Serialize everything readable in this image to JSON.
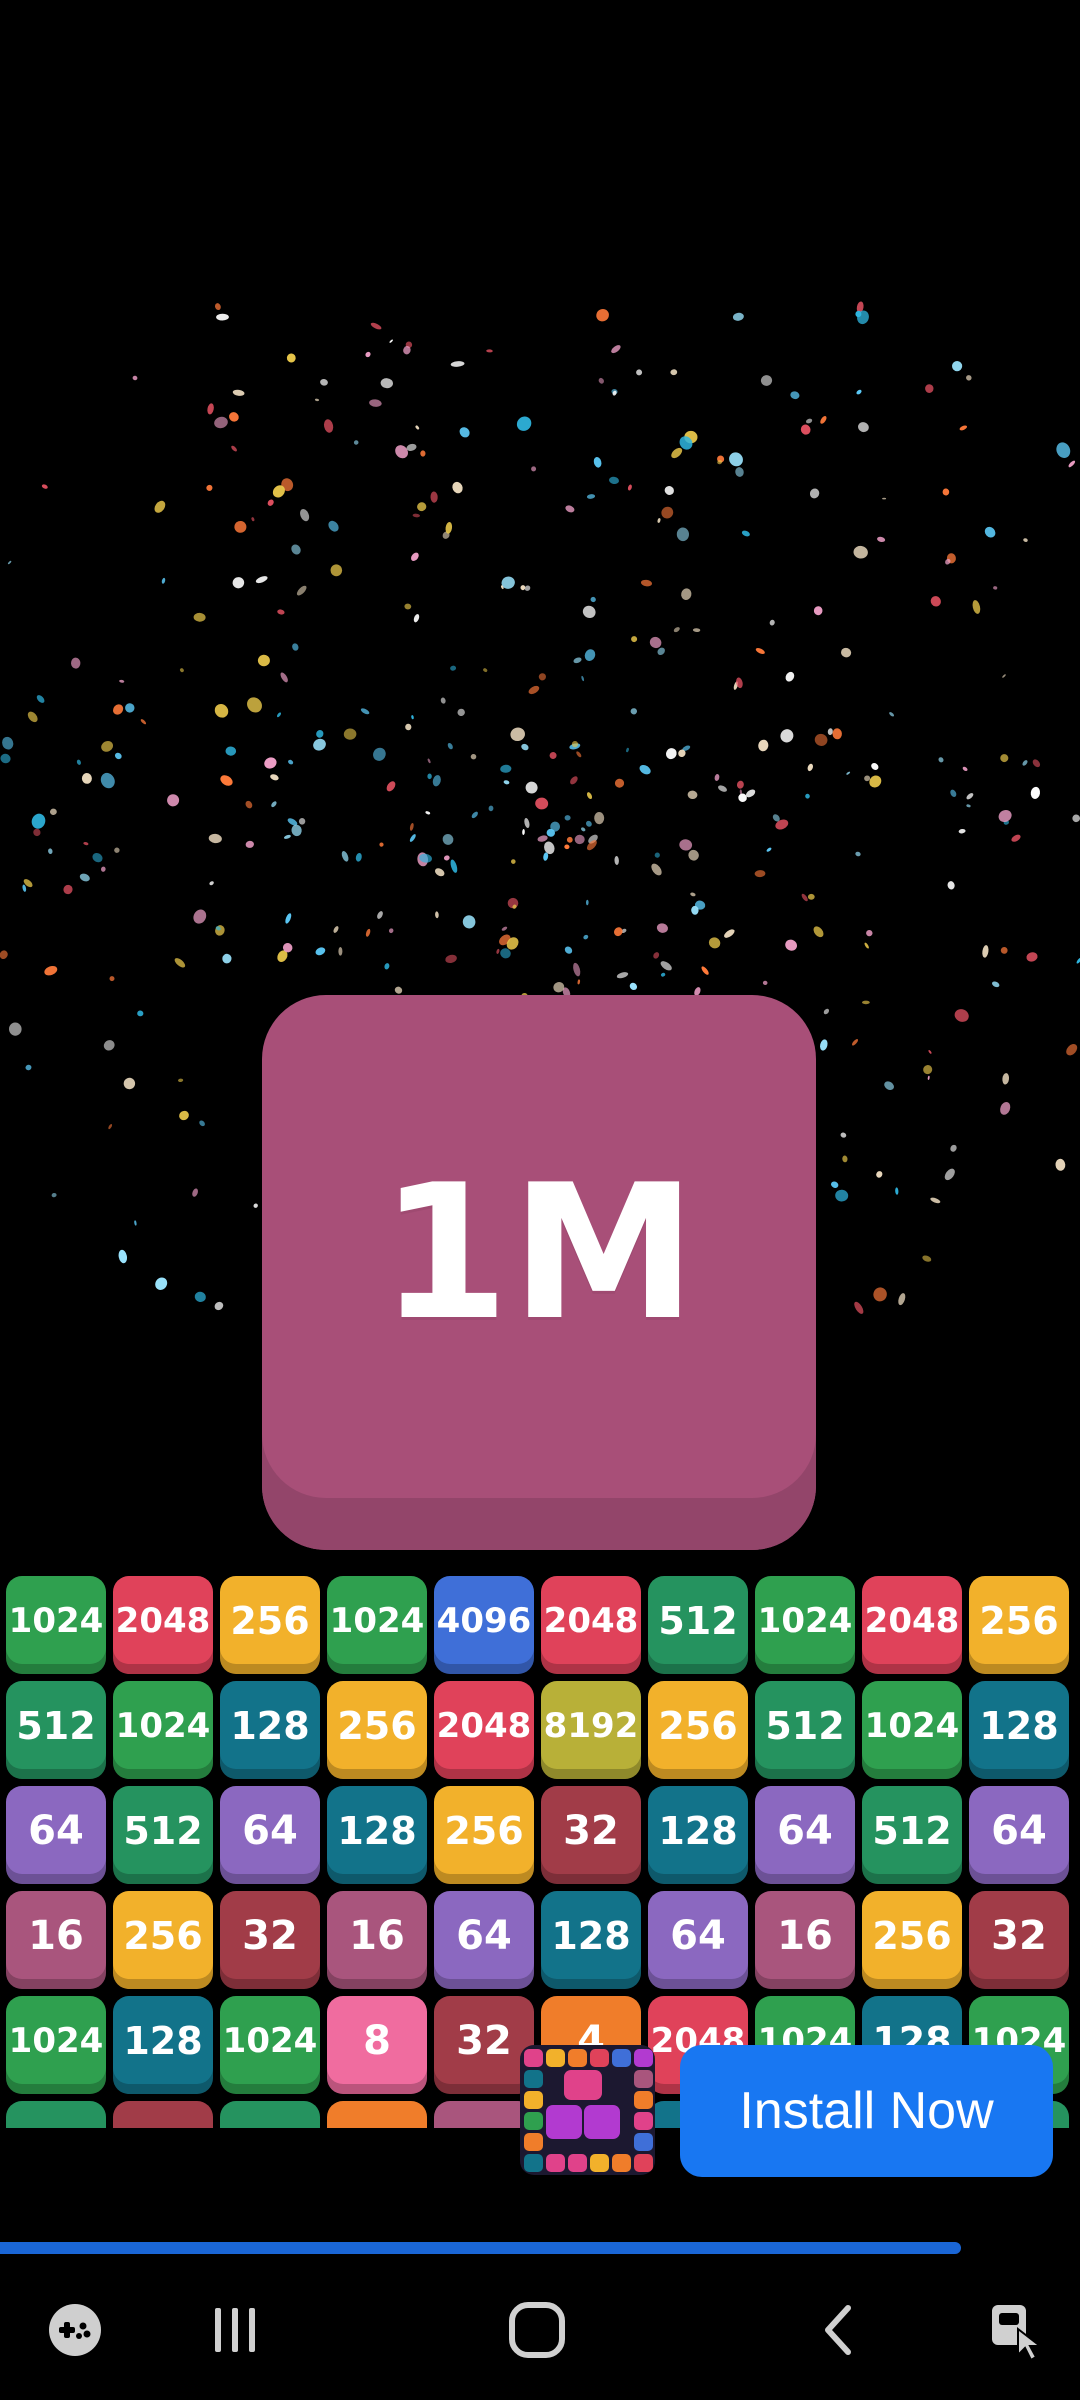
{
  "hero_tile": {
    "label": "1M",
    "color": "#a84f78"
  },
  "board": {
    "rows": [
      [
        "1024",
        "2048",
        "256",
        "1024",
        "4096",
        "2048",
        "512",
        "1024",
        "2048",
        "256"
      ],
      [
        "512",
        "1024",
        "128",
        "256",
        "2048",
        "8192",
        "256",
        "512",
        "1024",
        "128"
      ],
      [
        "64",
        "512",
        "64",
        "128",
        "256",
        "32",
        "128",
        "64",
        "512",
        "64"
      ],
      [
        "16",
        "256",
        "32",
        "16",
        "64",
        "128",
        "64",
        "16",
        "256",
        "32"
      ],
      [
        "1024",
        "128",
        "1024",
        "8",
        "32",
        "4",
        "2048",
        "1024",
        "128",
        "1024"
      ]
    ],
    "tile_colors": {
      "1024": "#2fa04f",
      "2048": "#e0425a",
      "256": "#f2b12b",
      "4096": "#3f6fd8",
      "512": "#25935f",
      "128": "#12738a",
      "8192": "#b8b038",
      "64": "#8b68c0",
      "32": "#a13c48",
      "16": "#a9557d",
      "8": "#f06c9f",
      "4": "#f07d2a"
    }
  },
  "ad": {
    "install_label": "Install Now",
    "logo_icon": "2048-blocks-app-icon",
    "progress": 0.89
  },
  "navbar": {
    "icons": [
      "game-launcher-icon",
      "recent-apps-icon",
      "home-icon",
      "back-icon",
      "screen-lock-icon"
    ]
  }
}
